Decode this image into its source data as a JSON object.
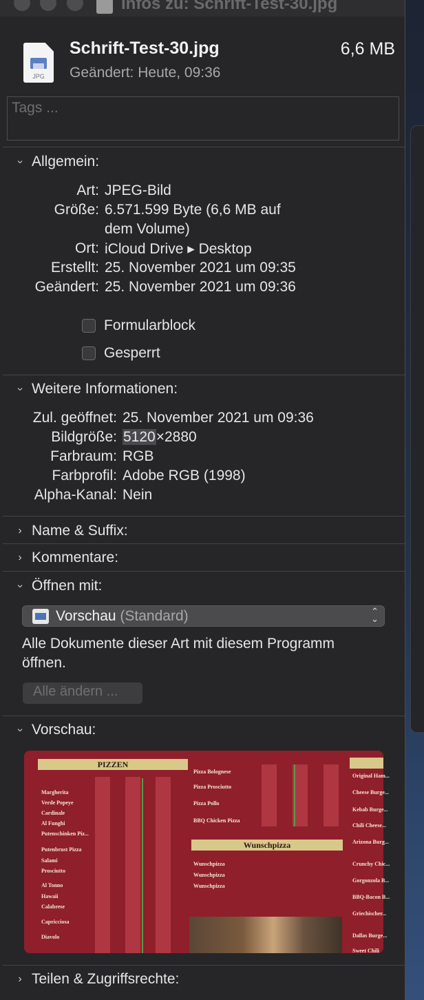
{
  "window": {
    "title": "Infos zu: Schrift-Test-30.jpg"
  },
  "file": {
    "name": "Schrift-Test-30.jpg",
    "size": "6,6 MB",
    "modified": "Geändert: Heute, 09:36",
    "icon_label": "JPG"
  },
  "tags": {
    "placeholder": "Tags ..."
  },
  "general": {
    "header": "Allgemein:",
    "kind_label": "Art:",
    "kind_value": "JPEG-Bild",
    "size_label": "Größe:",
    "size_value_1": "6.571.599 Byte (6,6 MB auf",
    "size_value_2": "dem Volume)",
    "where_label": "Ort:",
    "where_value": "iCloud Drive ▸ Desktop",
    "created_label": "Erstellt:",
    "created_value": "25. November 2021 um 09:35",
    "modified_label": "Geändert:",
    "modified_value": "25. November 2021 um 09:36",
    "stationery_label": "Formularblock",
    "locked_label": "Gesperrt"
  },
  "more_info": {
    "header": "Weitere Informationen:",
    "last_opened_label": "Zul. geöffnet:",
    "last_opened_value": "25. November 2021 um 09:36",
    "dimensions_label": "Bildgröße:",
    "dimensions_width": "5120",
    "dimensions_rest": "×2880",
    "colorspace_label": "Farbraum:",
    "colorspace_value": "RGB",
    "profile_label": "Farbprofil:",
    "profile_value": "Adobe RGB (1998)",
    "alpha_label": "Alpha-Kanal:",
    "alpha_value": "Nein"
  },
  "name_ext": {
    "header": "Name & Suffix:"
  },
  "comments": {
    "header": "Kommentare:"
  },
  "open_with": {
    "header": "Öffnen mit:",
    "app": "Vorschau",
    "app_suffix": "(Standard)",
    "description": "Alle Dokumente dieser Art mit diesem Programm öffnen.",
    "change_all": "Alle ändern ..."
  },
  "preview": {
    "header": "Vorschau:",
    "banner_pizzen": "PIZZEN",
    "banner_wunsch": "Wunschpizza",
    "items_left": [
      "Margherita",
      "Verde Popeye",
      "Cardinale",
      "Al Funghi",
      "Putenschinken Piz...",
      "Putenbrust Pizza",
      "Salami",
      "Prosciutto",
      "Al Tonno",
      "Hawaii",
      "Calabrese",
      "Capricciosa",
      "Diavolo"
    ],
    "items_mid": [
      "Pizza Bolognese",
      "Pizza Prosciutto",
      "Pizza Pollo",
      "BBQ Chicken Pizza"
    ],
    "items_mid_2": [
      "Wunschpizza",
      "Wunschpizza",
      "Wunschpizza"
    ],
    "items_right": [
      "Original Ham...",
      "Cheese Burge...",
      "Kebab Burge...",
      "Chili Cheese...",
      "Arizona Burg...",
      "Crunchy Chic...",
      "Gorgonzola B...",
      "BBQ-Bacon B...",
      "Griechischer...",
      "Dallas Burge...",
      "Sweet Chili"
    ]
  },
  "sharing": {
    "header": "Teilen & Zugriffsrechte:"
  }
}
